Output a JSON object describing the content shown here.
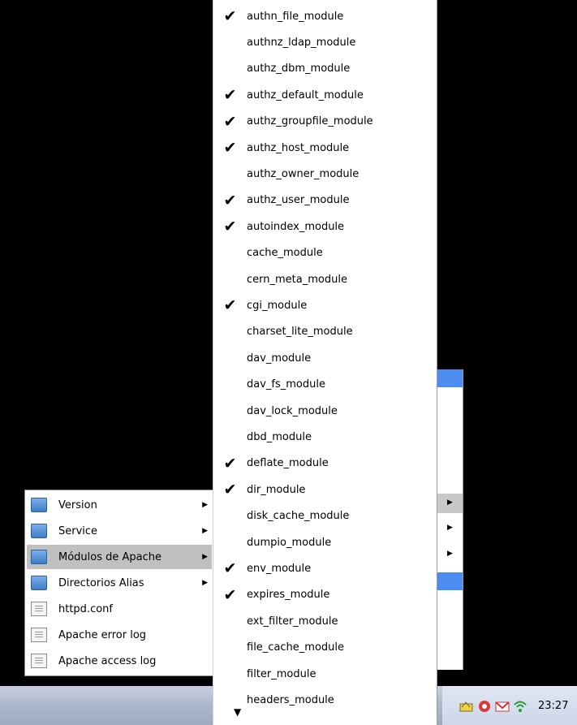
{
  "main_menu": {
    "items": [
      {
        "label": "Version",
        "icon": "folder",
        "submenu": true
      },
      {
        "label": "Service",
        "icon": "folder",
        "submenu": true
      },
      {
        "label": "Módulos de Apache",
        "icon": "folder",
        "submenu": true,
        "active": true
      },
      {
        "label": "Directorios Alias",
        "icon": "folder",
        "submenu": true
      },
      {
        "label": "httpd.conf",
        "icon": "document",
        "submenu": false
      },
      {
        "label": "Apache error log",
        "icon": "document",
        "submenu": false
      },
      {
        "label": "Apache access log",
        "icon": "document",
        "submenu": false
      }
    ]
  },
  "modules_menu": {
    "items": [
      {
        "name": "authn_file_module",
        "checked": true
      },
      {
        "name": "authnz_ldap_module",
        "checked": false
      },
      {
        "name": "authz_dbm_module",
        "checked": false
      },
      {
        "name": "authz_default_module",
        "checked": true
      },
      {
        "name": "authz_groupfile_module",
        "checked": true
      },
      {
        "name": "authz_host_module",
        "checked": true
      },
      {
        "name": "authz_owner_module",
        "checked": false
      },
      {
        "name": "authz_user_module",
        "checked": true
      },
      {
        "name": "autoindex_module",
        "checked": true
      },
      {
        "name": "cache_module",
        "checked": false
      },
      {
        "name": "cern_meta_module",
        "checked": false
      },
      {
        "name": "cgi_module",
        "checked": true
      },
      {
        "name": "charset_lite_module",
        "checked": false
      },
      {
        "name": "dav_module",
        "checked": false
      },
      {
        "name": "dav_fs_module",
        "checked": false
      },
      {
        "name": "dav_lock_module",
        "checked": false
      },
      {
        "name": "dbd_module",
        "checked": false
      },
      {
        "name": "deflate_module",
        "checked": true
      },
      {
        "name": "dir_module",
        "checked": true
      },
      {
        "name": "disk_cache_module",
        "checked": false
      },
      {
        "name": "dumpio_module",
        "checked": false
      },
      {
        "name": "env_module",
        "checked": true
      },
      {
        "name": "expires_module",
        "checked": true
      },
      {
        "name": "ext_filter_module",
        "checked": false
      },
      {
        "name": "file_cache_module",
        "checked": false
      },
      {
        "name": "filter_module",
        "checked": false
      },
      {
        "name": "headers_module",
        "checked": false
      }
    ],
    "check_glyph": "✔",
    "scroll_down_glyph": "▼"
  },
  "taskbar": {
    "clock": "23:27",
    "tray_icons": [
      "network-icon",
      "messenger-icon",
      "gmail-icon",
      "wifi-icon"
    ]
  },
  "colors": {
    "highlight": "#4b8df0",
    "active_item": "#c0c0c0"
  }
}
